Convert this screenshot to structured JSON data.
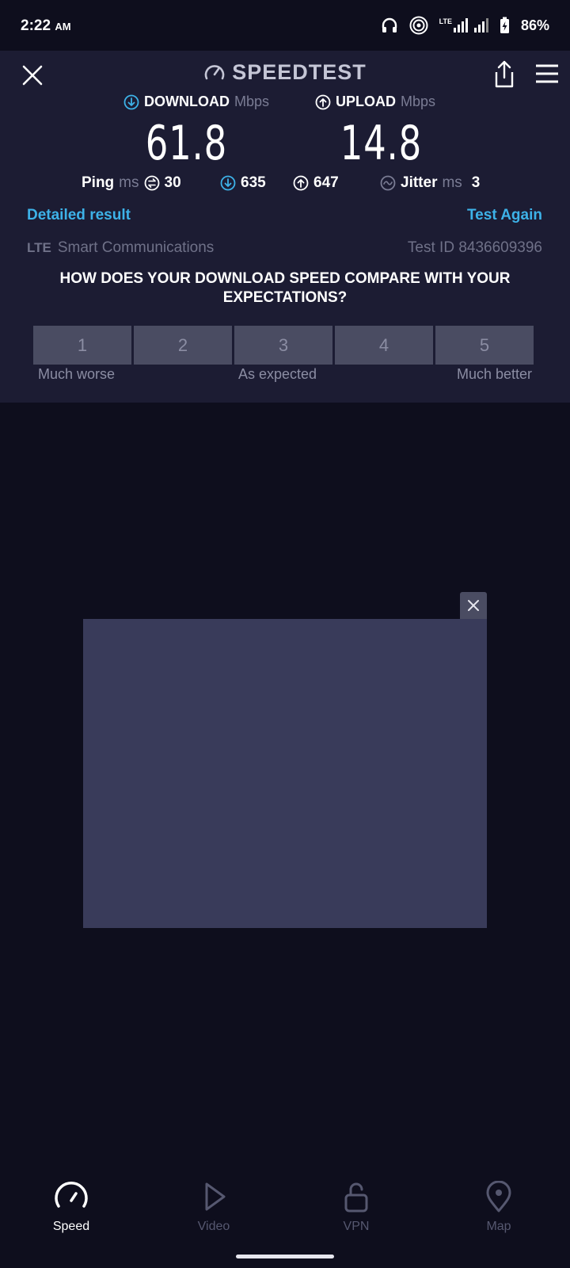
{
  "status_bar": {
    "time": "2:22",
    "ampm": "AM",
    "network": "LTE",
    "battery": "86%"
  },
  "header": {
    "title": "SPEEDTEST"
  },
  "download": {
    "label": "DOWNLOAD",
    "unit": "Mbps",
    "value": "61.8",
    "color": "#3db2e8"
  },
  "upload": {
    "label": "UPLOAD",
    "unit": "Mbps",
    "value": "14.8"
  },
  "stats": {
    "ping_label": "Ping",
    "ping_unit": "ms",
    "ping_value": "30",
    "download_latency": "635",
    "upload_latency": "647",
    "jitter_label": "Jitter",
    "jitter_unit": "ms",
    "jitter_value": "3"
  },
  "links": {
    "detailed": "Detailed result",
    "test_again": "Test Again"
  },
  "meta": {
    "network_type": "LTE",
    "provider": "Smart Communications",
    "test_id": "Test ID 8436609396"
  },
  "survey": {
    "question": "HOW DOES YOUR DOWNLOAD SPEED COMPARE WITH YOUR EXPECTATIONS?",
    "options": [
      "1",
      "2",
      "3",
      "4",
      "5"
    ],
    "low_label": "Much worse",
    "mid_label": "As expected",
    "high_label": "Much better"
  },
  "nav": {
    "speed": "Speed",
    "video": "Video",
    "vpn": "VPN",
    "map": "Map"
  }
}
